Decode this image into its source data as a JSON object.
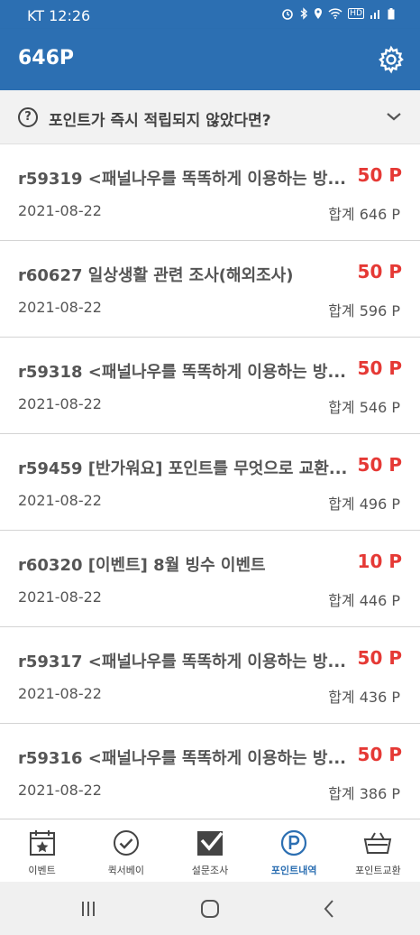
{
  "status_bar": {
    "carrier_time": "KT 12:26",
    "hd": "HD"
  },
  "app_bar": {
    "title": "646P"
  },
  "notice": {
    "text": "포인트가 즉시 적립되지 않았다면?",
    "icon": "?"
  },
  "history": [
    {
      "title": "r59319 <패널나우를 똑똑하게 이용하는 방...",
      "points": "50 P",
      "date": "2021-08-22",
      "total": "합계 646 P"
    },
    {
      "title": "r60627 일상생활 관련 조사(해외조사)",
      "points": "50 P",
      "date": "2021-08-22",
      "total": "합계 596 P"
    },
    {
      "title": "r59318 <패널나우를 똑똑하게 이용하는 방...",
      "points": "50 P",
      "date": "2021-08-22",
      "total": "합계 546 P"
    },
    {
      "title": "r59459 [반가워요] 포인트를 무엇으로 교환...",
      "points": "50 P",
      "date": "2021-08-22",
      "total": "합계 496 P"
    },
    {
      "title": "r60320 [이벤트] 8월 빙수 이벤트",
      "points": "10 P",
      "date": "2021-08-22",
      "total": "합계 446 P"
    },
    {
      "title": "r59317 <패널나우를 똑똑하게 이용하는 방...",
      "points": "50 P",
      "date": "2021-08-22",
      "total": "합계 436 P"
    },
    {
      "title": "r59316 <패널나우를 똑똑하게 이용하는 방...",
      "points": "50 P",
      "date": "2021-08-22",
      "total": "합계 386 P"
    }
  ],
  "bottom_nav": [
    {
      "label": "이벤트",
      "icon": "calendar-star-icon"
    },
    {
      "label": "퀵서베이",
      "icon": "check-circle-icon"
    },
    {
      "label": "설문조사",
      "icon": "survey-check-icon"
    },
    {
      "label": "포인트내역",
      "icon": "point-p-icon",
      "active": true
    },
    {
      "label": "포인트교환",
      "icon": "basket-icon"
    }
  ],
  "colors": {
    "primary": "#2c6fb2",
    "points_red": "#e53935"
  }
}
